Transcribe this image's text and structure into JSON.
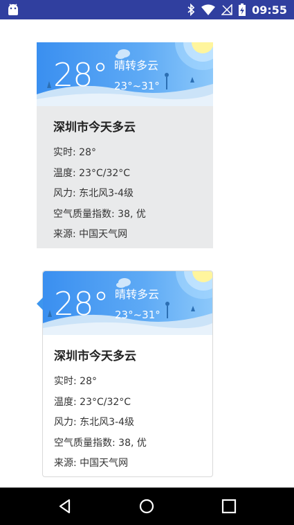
{
  "status_bar": {
    "time": "09:55",
    "icons": [
      "android-icon",
      "bluetooth-icon",
      "wifi-icon",
      "signal-off-icon",
      "battery-charging-icon"
    ],
    "background": "#303F9F"
  },
  "cards": [
    {
      "style": "flat-gray",
      "weather": {
        "temperature": "28°",
        "condition": "晴转多云",
        "range": "23°~31°"
      },
      "city_title": "深圳市今天多云",
      "details": [
        "实时: 28°",
        "温度: 23°C/32°C",
        "风力: 东北风3-4级",
        "空气质量指数: 38, 优",
        "来源: 中国天气网"
      ]
    },
    {
      "style": "bubble-white",
      "weather": {
        "temperature": "28°",
        "condition": "晴转多云",
        "range": "23°~31°"
      },
      "city_title": "深圳市今天多云",
      "details": [
        "实时: 28°",
        "温度: 23°C/32°C",
        "风力: 东北风3-4级",
        "空气质量指数: 38, 优",
        "来源: 中国天气网"
      ]
    }
  ],
  "nav_bar": {
    "buttons": [
      "back-button",
      "home-button",
      "recents-button"
    ]
  },
  "colors": {
    "banner_blue": "#3d96ee",
    "card_gray": "#e9eaeb",
    "sun_yellow": "#fff59d"
  }
}
